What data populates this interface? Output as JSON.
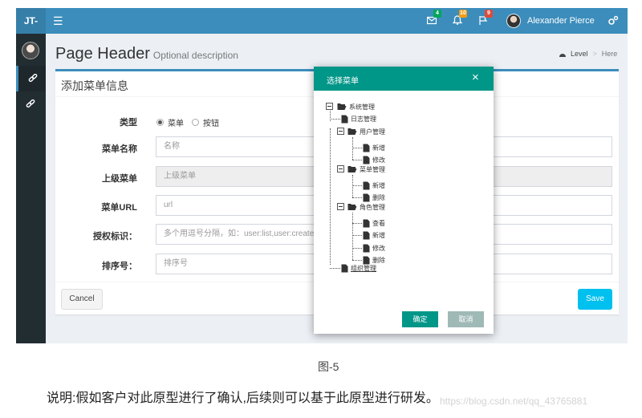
{
  "navbar": {
    "logo": "JT-",
    "toggle_icon": "☰",
    "mail_count": "4",
    "notification_count": "10",
    "flag_count": "9",
    "user_name": "Alexander Pierce",
    "colors": {
      "navbar": "#3c8dbc",
      "sidebar": "#222d32"
    }
  },
  "page": {
    "title": "Page Header",
    "description": "Optional description",
    "breadcrumb": {
      "level": "Level",
      "separator": ">",
      "here": "Here"
    }
  },
  "form": {
    "title": "添加菜单信息",
    "type_label": "类型",
    "type_options": [
      "菜单",
      "按钮"
    ],
    "name_label": "菜单名称",
    "name_placeholder": "名称",
    "parent_label": "上级菜单",
    "parent_placeholder": "上级菜单",
    "url_label": "菜单URL",
    "url_placeholder": "url",
    "perm_label": "授权标识：",
    "perm_placeholder": "多个用逗号分隔，如：user:list,user:create",
    "sort_label": "排序号：",
    "sort_placeholder": "排序号",
    "cancel_label": "Cancel",
    "save_label": "Save"
  },
  "modal": {
    "title": "选择菜单",
    "close_label": "×",
    "tree": {
      "system": "系统管理",
      "log": "日志管理",
      "user": "用户管理",
      "user_add": "新增",
      "user_edit": "修改",
      "menu": "菜单管理",
      "menu_add": "新增",
      "menu_del": "删除",
      "role": "角色管理",
      "role_view": "查看",
      "role_add": "新增",
      "role_edit": "修改",
      "role_del": "删除",
      "org": "组织管理"
    },
    "ok_label": "确定",
    "cancel_label": "取消",
    "accent": "#009688"
  },
  "caption": {
    "figure": "图-5",
    "note": "说明:假如客户对此原型进行了确认,后续则可以基于此原型进行研发。",
    "watermark": "https://blog.csdn.net/qq_43765881"
  }
}
